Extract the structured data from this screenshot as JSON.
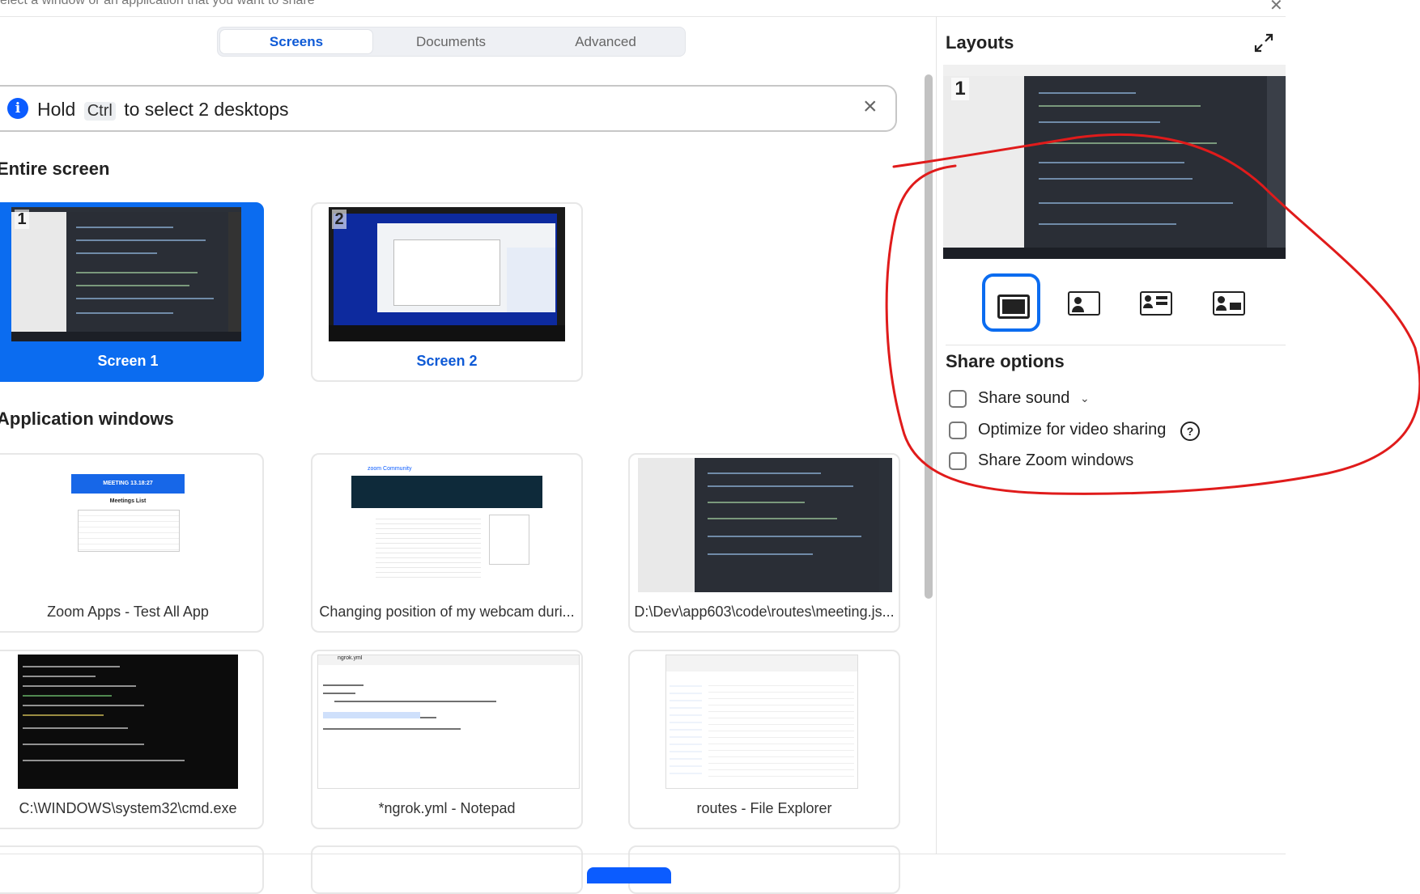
{
  "header": {
    "title": "elect a window or an application that you want to share"
  },
  "tabs": [
    {
      "label": "Screens",
      "active": true
    },
    {
      "label": "Documents",
      "active": false
    },
    {
      "label": "Advanced",
      "active": false
    }
  ],
  "notice": {
    "prefix": "Hold",
    "key": "Ctrl",
    "suffix": "to select 2 desktops"
  },
  "sections": {
    "entire_screen": "Entire screen",
    "app_windows": "Application windows"
  },
  "screens": [
    {
      "label": "Screen 1",
      "number": "1",
      "selected": true
    },
    {
      "label": "Screen 2",
      "number": "2",
      "selected": false
    }
  ],
  "apps": [
    {
      "label": "Zoom Apps - Test All App"
    },
    {
      "label": "Changing position of my webcam duri..."
    },
    {
      "label": "D:\\Dev\\app603\\code\\routes\\meeting.js..."
    },
    {
      "label": "C:\\WINDOWS\\system32\\cmd.exe"
    },
    {
      "label": "*ngrok.yml - Notepad"
    },
    {
      "label": "routes - File Explorer"
    }
  ],
  "thumb_text": {
    "meeting_banner": "MEETING 13.18:27",
    "meetings_list": "Meetings List",
    "zoom_community": "zoom Community",
    "notepad_tab": "ngrok.yml"
  },
  "layouts": {
    "title": "Layouts",
    "preview_number": "1",
    "options": [
      {
        "icon": "screen-only-icon",
        "active": true
      },
      {
        "icon": "screen-with-camera-icon",
        "active": false
      },
      {
        "icon": "camera-over-screen-icon",
        "active": false
      },
      {
        "icon": "camera-beside-screen-icon",
        "active": false
      }
    ]
  },
  "share_options": {
    "title": "Share options",
    "items": [
      {
        "label": "Share sound",
        "checked": false
      },
      {
        "label": "Optimize for video sharing",
        "checked": false
      },
      {
        "label": "Share Zoom windows",
        "checked": false
      }
    ],
    "help_glyph": "?"
  },
  "colors": {
    "accent": "#0b6cf0",
    "annotation": "#e01b1b"
  }
}
